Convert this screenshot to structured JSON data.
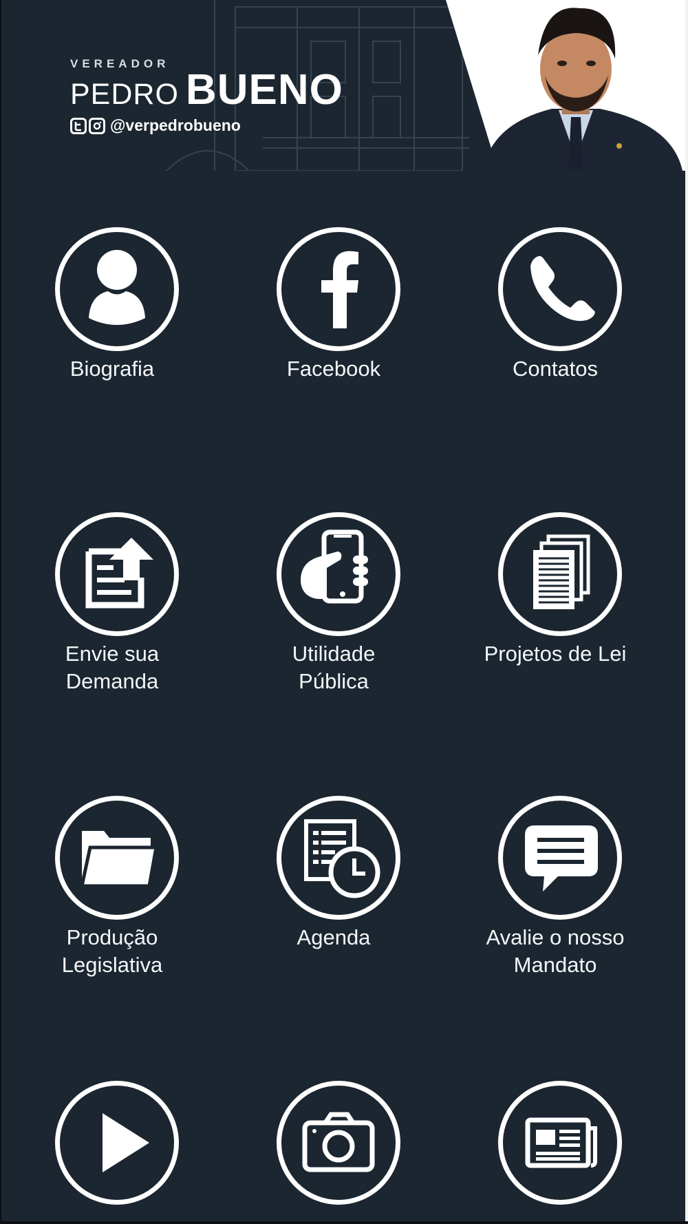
{
  "header": {
    "title_small": "VEREADOR",
    "name_first": "PEDRO",
    "name_last": "BUENO",
    "social_handle": "@verpedrobueno"
  },
  "menu": [
    {
      "label_line1": "Biografia",
      "label_line2": "",
      "icon": "person-icon"
    },
    {
      "label_line1": "Facebook",
      "label_line2": "",
      "icon": "facebook-icon"
    },
    {
      "label_line1": "Contatos",
      "label_line2": "",
      "icon": "phone-icon"
    },
    {
      "label_line1": "Envie sua",
      "label_line2": "Demanda",
      "icon": "upload-document-icon"
    },
    {
      "label_line1": "Utilidade",
      "label_line2": "Pública",
      "icon": "hand-smartphone-icon"
    },
    {
      "label_line1": "Projetos de Lei",
      "label_line2": "",
      "icon": "documents-stack-icon"
    },
    {
      "label_line1": "Produção",
      "label_line2": "Legislativa",
      "icon": "folder-icon"
    },
    {
      "label_line1": "Agenda",
      "label_line2": "",
      "icon": "calendar-clock-icon"
    },
    {
      "label_line1": "Avalie o nosso",
      "label_line2": "Mandato",
      "icon": "chat-bubble-icon"
    },
    {
      "label_line1": "",
      "label_line2": "",
      "icon": "play-icon"
    },
    {
      "label_line1": "",
      "label_line2": "",
      "icon": "camera-icon"
    },
    {
      "label_line1": "",
      "label_line2": "",
      "icon": "newspaper-icon"
    }
  ],
  "colors": {
    "background": "#1b2630",
    "foreground": "#ffffff"
  }
}
